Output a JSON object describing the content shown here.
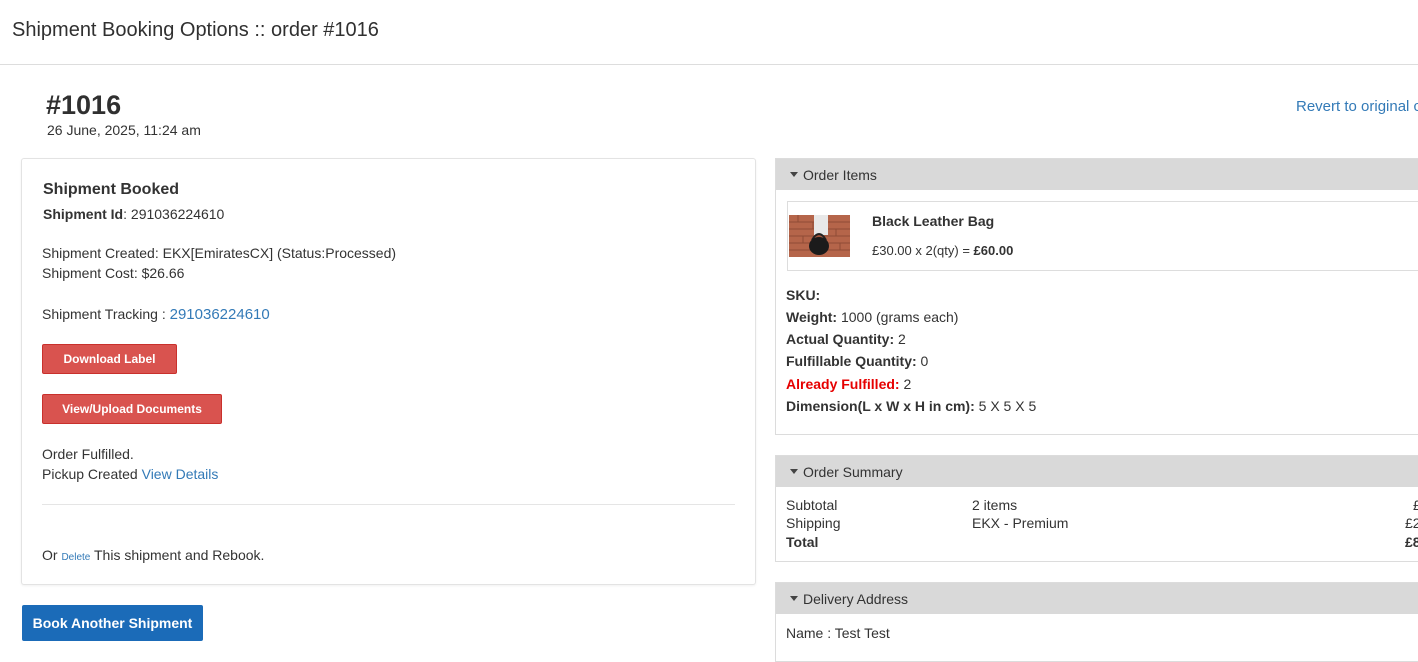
{
  "header": {
    "title": "Shipment Booking Options :: order #1016"
  },
  "order": {
    "number": "#1016",
    "date": "26 June, 2025, 11:24 am",
    "revert_link": "Revert to original c"
  },
  "shipment": {
    "title": "Shipment Booked",
    "id_label": "Shipment Id",
    "id_value": ": 291036224610",
    "created": "Shipment Created: EKX[EmiratesCX] (Status:Processed)",
    "cost": "Shipment Cost: $26.66",
    "tracking_label": "Shipment Tracking : ",
    "tracking_number": "291036224610",
    "download_label": "Download Label",
    "docs_label": "View/Upload Documents",
    "fulfilled_text": "Order Fulfilled.",
    "pickup_text": "Pickup Created ",
    "pickup_link": "View Details",
    "rebook_prefix": "Or ",
    "delete_link": "Delete",
    "rebook_suffix": " This shipment and Rebook."
  },
  "book_another_label": "Book Another Shipment",
  "order_items": {
    "heading": "Order Items",
    "item": {
      "name": "Black Leather Bag",
      "price_text": "£30.00 x 2(qty) = ",
      "price_total": "£60.00"
    },
    "details": {
      "sku_label": "SKU:",
      "weight_label": "Weight:",
      "weight_value": " 1000 (grams each)",
      "actual_qty_label": "Actual Quantity:",
      "actual_qty_value": " 2",
      "fulfillable_label": "Fulfillable Quantity:",
      "fulfillable_value": " 0",
      "already_label": "Already Fulfilled:",
      "already_value": " 2",
      "dimension_label": "Dimension(L x W x H in cm):",
      "dimension_value": " 5 X 5 X 5"
    }
  },
  "order_summary": {
    "heading": "Order Summary",
    "rows": [
      {
        "label": "Subtotal",
        "desc": "2 items",
        "amount": "£"
      },
      {
        "label": "Shipping",
        "desc": "EKX - Premium",
        "amount": "£2"
      },
      {
        "label": "Total",
        "desc": "",
        "amount": "£8"
      }
    ]
  },
  "delivery_address": {
    "heading": "Delivery Address",
    "name": "Name : Test Test"
  },
  "colors": {
    "accent_link": "#337ab7",
    "danger_button": "#d9534f",
    "primary_button": "#1b6bb8",
    "warning_text": "#e60000",
    "panel_header": "#d9d9d9"
  }
}
